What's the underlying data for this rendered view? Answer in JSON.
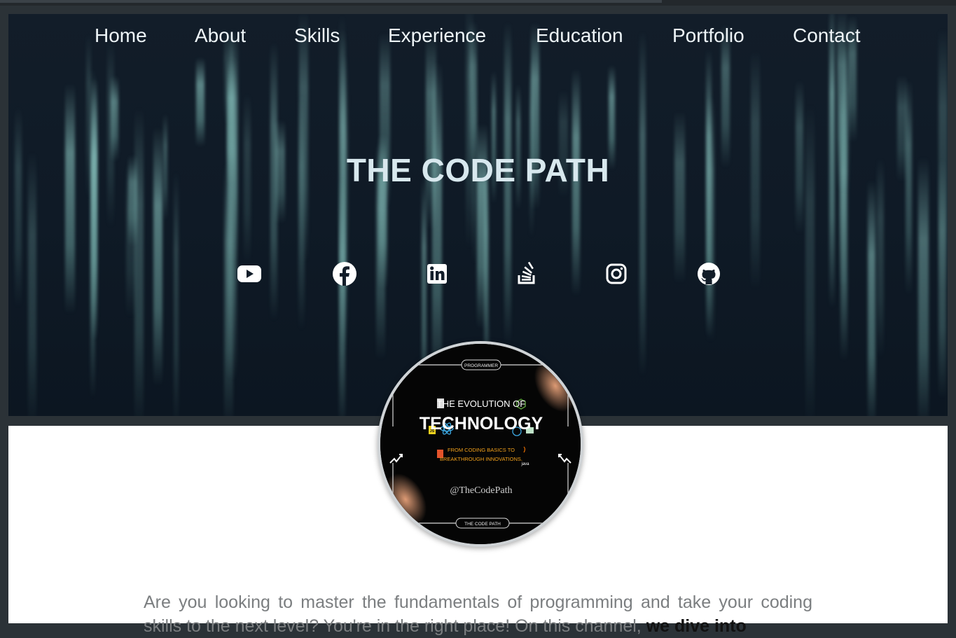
{
  "nav": {
    "items": [
      {
        "label": "Home"
      },
      {
        "label": "About"
      },
      {
        "label": "Skills"
      },
      {
        "label": "Experience"
      },
      {
        "label": "Education"
      },
      {
        "label": "Portfolio"
      },
      {
        "label": "Contact"
      }
    ]
  },
  "hero": {
    "title": "THE CODE PATH"
  },
  "social": [
    {
      "icon": "youtube-icon"
    },
    {
      "icon": "facebook-icon"
    },
    {
      "icon": "linkedin-icon"
    },
    {
      "icon": "stackoverflow-icon"
    },
    {
      "icon": "instagram-icon"
    },
    {
      "icon": "github-icon"
    }
  ],
  "avatar": {
    "top_tag": "PROGRAMMER",
    "line1": "THE EVOLUTION OF",
    "line2": "TECHNOLOGY",
    "line3": "FROM CODING BASICS TO",
    "line4": "BREAKTHROUGH INNOVATIONS.",
    "handle": "@TheCodePath",
    "bottom_tag": "THE CODE PATH",
    "badge_js": "JS",
    "badge_java": "java"
  },
  "about": {
    "text": "Are you looking to master the fundamentals of programming and take your coding skills to the next level? You're in the right place! On this channel, ",
    "bold": "we dive into"
  },
  "colors": {
    "hero_bg": "#121d29",
    "title": "#d8e8ee",
    "nav_text": "#eef5f8",
    "page_bg": "#2b3237"
  }
}
